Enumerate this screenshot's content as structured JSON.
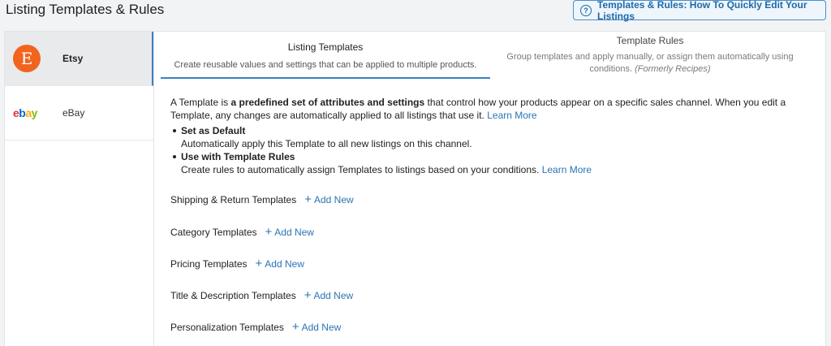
{
  "header": {
    "title": "Listing Templates & Rules",
    "help_button": "Templates & Rules: How To Quickly Edit Your Listings",
    "help_icon": "?"
  },
  "sidebar": {
    "items": [
      {
        "label": "Etsy",
        "logo": "E",
        "active": true
      },
      {
        "label": "eBay",
        "logo_letters": [
          "e",
          "b",
          "a",
          "y"
        ],
        "active": false
      }
    ]
  },
  "tabs": [
    {
      "title": "Listing Templates",
      "desc": "Create reusable values and settings that can be applied to multiple products."
    },
    {
      "title": "Template Rules",
      "desc": "Group templates and apply manually, or assign them automatically using conditions.",
      "note": "(Formerly Recipes)"
    }
  ],
  "intro": {
    "text_before": "A Template is ",
    "text_bold": "a predefined set of attributes and settings",
    "text_after": " that control how your products appear on a specific sales channel. When you edit a Template, any changes are automatically applied to all listings that use it. ",
    "link": "Learn More"
  },
  "bullets": [
    {
      "title": "Set as Default",
      "desc": "Automatically apply this Template to all new listings on this channel.",
      "link": ""
    },
    {
      "title": "Use with Template Rules",
      "desc": "Create rules to automatically assign Templates to listings based on your conditions. ",
      "link": "Learn More"
    }
  ],
  "template_sections": [
    {
      "label": "Shipping & Return Templates",
      "add": "Add New"
    },
    {
      "label": "Category Templates",
      "add": "Add New"
    },
    {
      "label": "Pricing Templates",
      "add": "Add New"
    },
    {
      "label": "Title & Description Templates",
      "add": "Add New"
    },
    {
      "label": "Personalization Templates",
      "add": "Add New"
    }
  ],
  "colors": {
    "accent": "#2a74b5",
    "etsy": "#f1641e"
  }
}
